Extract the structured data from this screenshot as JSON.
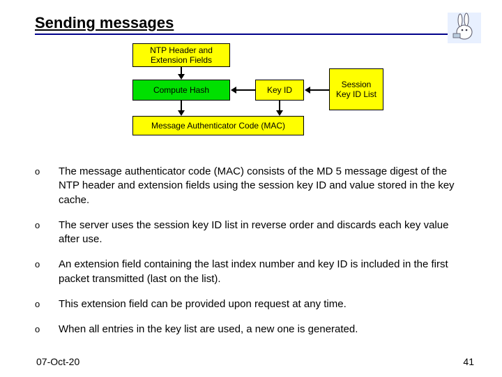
{
  "title": "Sending messages",
  "diagram": {
    "box_ntp": "NTP Header and Extension Fields",
    "box_compute": "Compute Hash",
    "box_keyid": "Key ID",
    "box_session": "Session Key ID List",
    "box_mac": "Message Authenticator Code (MAC)"
  },
  "bullets": [
    "The message authenticator code (MAC) consists of the MD 5 message digest of the NTP header and extension fields using the session key ID and value stored in the key cache.",
    "The server uses the session key ID list in reverse order and discards each key value after use.",
    "An extension field containing the last index number and key ID is included in the first packet transmitted (last on the list).",
    "This extension field can be provided upon request at any time.",
    "When all entries in the key list are used, a new one is generated."
  ],
  "bullet_marker": "o",
  "footer": {
    "date": "07-Oct-20",
    "page": "41"
  }
}
